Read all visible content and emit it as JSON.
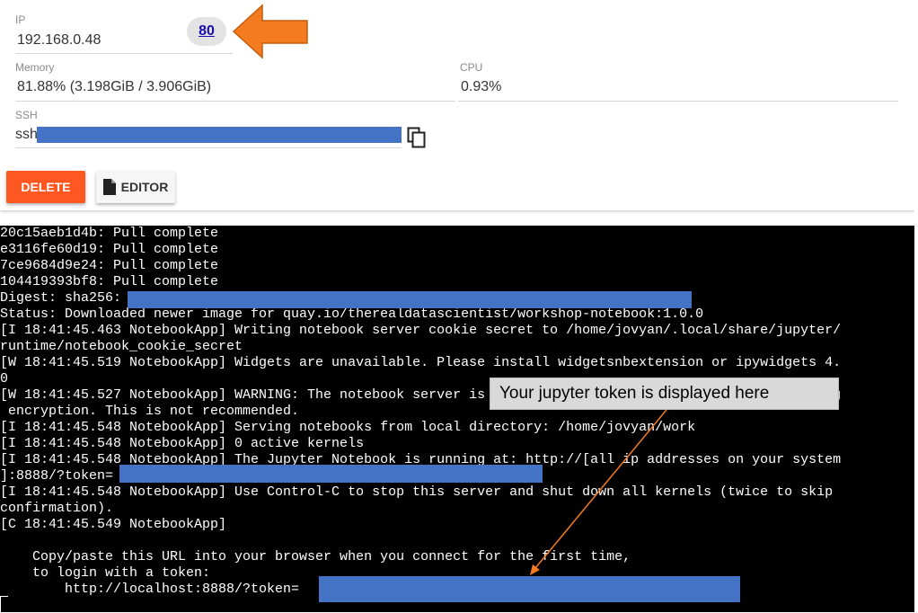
{
  "vm": {
    "ip_label": "IP",
    "ip_value": "192.168.0.48",
    "port": "80",
    "memory_label": "Memory",
    "memory_value": "81.88% (3.198GiB / 3.906GiB)",
    "cpu_label": "CPU",
    "cpu_value": "0.93%",
    "ssh_label": "SSH",
    "ssh_prefix": "ssh",
    "delete_label": "DELETE",
    "editor_label": "EDITOR"
  },
  "terminal": {
    "lines": [
      "20c15aeb1d4b: Pull complete",
      "e3116fe60d19: Pull complete",
      "7ce9684d9e24: Pull complete",
      "104419393bf8: Pull complete",
      "Digest: sha256:",
      "Status: Downloaded newer image for quay.io/therealdatascientist/workshop-notebook:1.0.0",
      "[I 18:41:45.463 NotebookApp] Writing notebook server cookie secret to /home/jovyan/.local/share/jupyter/",
      "runtime/notebook_cookie_secret",
      "[W 18:41:45.519 NotebookApp] Widgets are unavailable. Please install widgetsnbextension or ipywidgets 4.",
      "0",
      "[W 18:41:45.527 NotebookApp] WARNING: The notebook server is listening on all IP addresses and not using",
      " encryption. This is not recommended.",
      "[I 18:41:45.548 NotebookApp] Serving notebooks from local directory: /home/jovyan/work",
      "[I 18:41:45.548 NotebookApp] 0 active kernels",
      "[I 18:41:45.548 NotebookApp] The Jupyter Notebook is running at: http://[all ip addresses on your system",
      "]:8888/?token=",
      "[I 18:41:45.548 NotebookApp] Use Control-C to stop this server and shut down all kernels (twice to skip",
      "confirmation).",
      "[C 18:41:45.549 NotebookApp]",
      "",
      "    Copy/paste this URL into your browser when you connect for the first time,",
      "    to login with a token:",
      "        http://localhost:8888/?token="
    ]
  },
  "annotation": {
    "tooltip": "Your jupyter token is displayed here"
  },
  "colors": {
    "accent_orange": "#f47b20",
    "delete_red": "#ff5722",
    "redaction_blue": "#4472c4"
  },
  "icons": {
    "copy": "copy-icon",
    "editor": "file-icon",
    "arrow": "arrow-left-icon"
  }
}
